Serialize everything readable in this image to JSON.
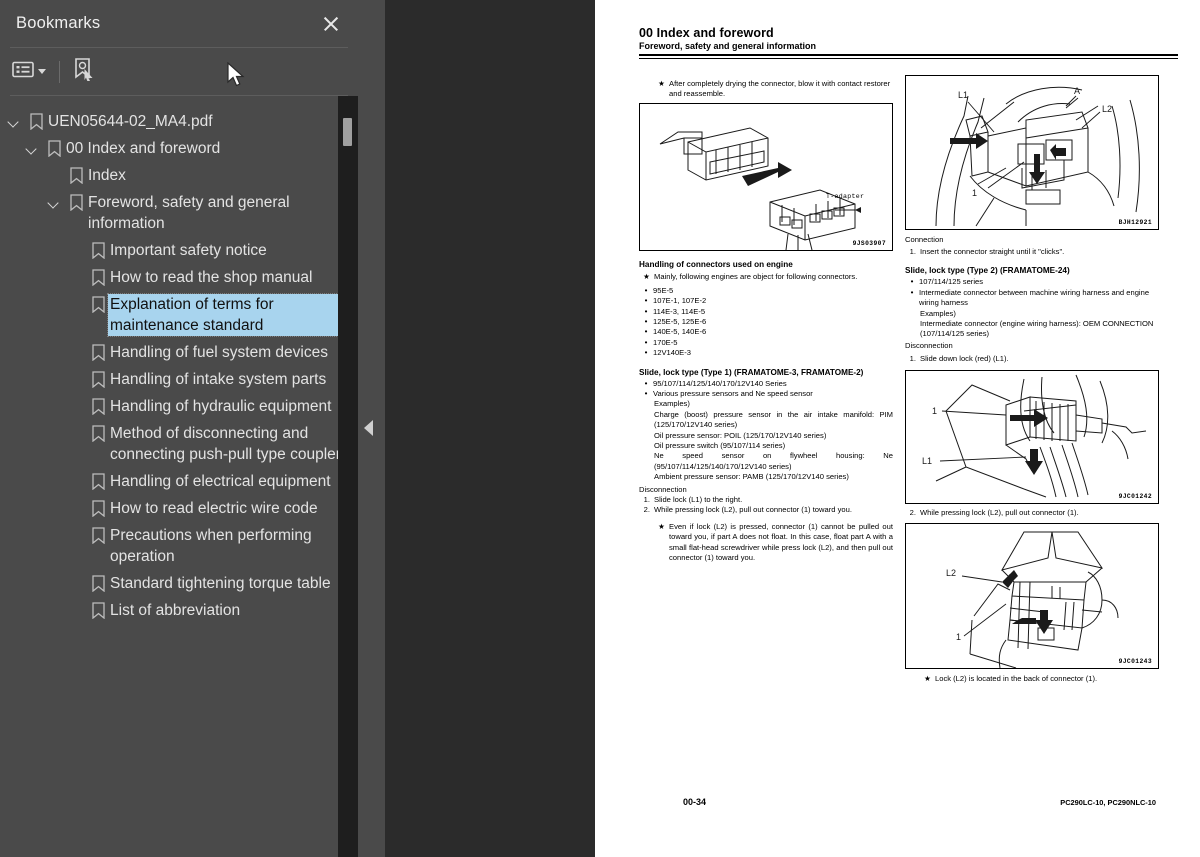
{
  "sidebar": {
    "title": "Bookmarks",
    "close_icon": "close-icon",
    "toolbar": {
      "options_icon": "list-options-icon",
      "dropdown_icon": "chevron-down-icon",
      "find_bookmark_icon": "bookmark-pointer-icon"
    },
    "tree": [
      {
        "level": 0,
        "label": "UEN05644-02_MA4.pdf",
        "expanded": true,
        "selected": false
      },
      {
        "level": 1,
        "label": "00 Index and foreword",
        "expanded": true,
        "selected": false
      },
      {
        "level": 2,
        "label": "Index",
        "expanded": null,
        "selected": false
      },
      {
        "level": 2,
        "label": "Foreword, safety and general information",
        "expanded": true,
        "selected": false
      },
      {
        "level": 3,
        "label": "Important safety notice",
        "expanded": null,
        "selected": false
      },
      {
        "level": 3,
        "label": "How to read the shop manual",
        "expanded": null,
        "selected": false
      },
      {
        "level": 3,
        "label": "Explanation of terms for maintenance standard",
        "expanded": null,
        "selected": true
      },
      {
        "level": 3,
        "label": "Handling of fuel system devices",
        "expanded": null,
        "selected": false
      },
      {
        "level": 3,
        "label": "Handling of intake system parts",
        "expanded": null,
        "selected": false
      },
      {
        "level": 3,
        "label": "Handling of hydraulic equipment",
        "expanded": null,
        "selected": false
      },
      {
        "level": 3,
        "label": "Method of disconnecting and connecting push-pull type coupler",
        "expanded": null,
        "selected": false
      },
      {
        "level": 3,
        "label": "Handling of electrical equipment",
        "expanded": null,
        "selected": false
      },
      {
        "level": 3,
        "label": "How to read electric wire code",
        "expanded": null,
        "selected": false
      },
      {
        "level": 3,
        "label": "Precautions when performing operation",
        "expanded": null,
        "selected": false
      },
      {
        "level": 3,
        "label": "Standard tightening torque table",
        "expanded": null,
        "selected": false
      },
      {
        "level": 3,
        "label": "List of abbreviation",
        "expanded": null,
        "selected": false
      }
    ]
  },
  "splitter": {
    "collapse_icon": "triangle-left-icon"
  },
  "document": {
    "header": {
      "title": "00 Index and foreword",
      "subtitle": "Foreword, safety and general information"
    },
    "left_column": {
      "note_top": "After completely drying the connector, blow it with contact restorer and reassemble.",
      "fig1_code": "9JS03907",
      "fig1_label": "T-adapter",
      "section1_title": "Handling of connectors used on engine",
      "section1_note": "Mainly, following engines are object for following connectors.",
      "engine_list": [
        "95E-5",
        "107E-1, 107E-2",
        "114E-3, 114E-5",
        "125E-5, 125E-6",
        "140E-5, 140E-6",
        "170E-5",
        "12V140E-3"
      ],
      "section2_title": "Slide, lock type (Type 1) (FRAMATOME-3, FRAMATOME-2)",
      "section2_bullets": [
        "95/107/114/125/140/170/12V140 Series",
        "Various pressure sensors and Ne speed sensor"
      ],
      "section2_examples_label": "Examples)",
      "section2_examples": [
        "Charge (boost) pressure sensor in the air intake manifold: PIM (125/170/12V140 series)",
        "Oil pressure sensor: POIL (125/170/12V140 series)",
        "Oil pressure switch (95/107/114 series)",
        "Ne speed sensor on flywheel housing: Ne (95/107/114/125/140/170/12V140 series)",
        "Ambient pressure sensor: PAMB (125/170/12V140 series)"
      ],
      "disconnection_label": "Disconnection",
      "disconnection_steps": [
        "Slide lock (L1) to the right.",
        "While pressing lock (L2), pull out connector (1) toward you."
      ],
      "disconnection_note": "Even if lock (L2) is pressed, connector (1) cannot be pulled out toward you, if part A does not float. In this case, float part A with a small flat-head screwdriver while press lock (L2), and then pull out connector (1) toward you."
    },
    "right_column": {
      "fig2_code": "BJH12921",
      "fig2_labels": [
        "L1",
        "A",
        "L2",
        "1"
      ],
      "connection_label": "Connection",
      "connection_step": "Insert the connector straight until it \"clicks\".",
      "section3_title": "Slide, lock type (Type 2) (FRAMATOME-24)",
      "section3_bullets": [
        "107/114/125 series",
        "Intermediate connector between machine wiring harness and engine wiring harness"
      ],
      "section3_examples_label": "Examples)",
      "section3_examples": [
        "Intermediate connector (engine wiring harness): OEM CONNECTION (107/114/125 series)"
      ],
      "disconnection_label": "Disconnection",
      "step1": "Slide down lock (red) (L1).",
      "fig3_code": "9JC01242",
      "fig3_labels": [
        "1",
        "L1"
      ],
      "step2": "While pressing lock (L2), pull out connector (1).",
      "fig4_code": "9JC01243",
      "fig4_labels": [
        "L2",
        "1"
      ],
      "note_bottom": "Lock (L2) is located in the back of connector (1)."
    },
    "footer": {
      "page_number": "00-34",
      "model": "PC290LC-10, PC290NLC-10"
    }
  },
  "colors": {
    "sidebar_bg": "#4a4a4a",
    "viewer_bg": "#2b2b2b",
    "selection": "#a8d4ee",
    "page_bg": "#ffffff"
  }
}
